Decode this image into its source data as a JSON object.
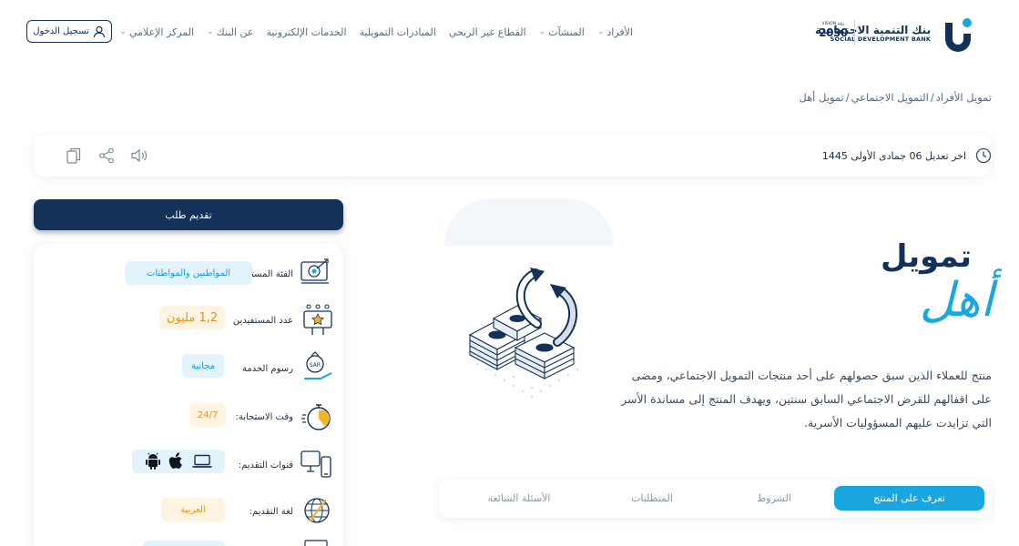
{
  "header": {
    "logo_ar": "بنك التنمية الاجتماعية",
    "logo_en": "SOCIAL DEVELOPMENT BANK",
    "vision_small": "رؤية VISION",
    "vision_big": "2030",
    "nav": [
      {
        "label": "الأفراد",
        "has_dropdown": true
      },
      {
        "label": "المنشآت",
        "has_dropdown": true
      },
      {
        "label": "القطاع غير الربحي",
        "has_dropdown": false
      },
      {
        "label": "المبادرات التمويلية",
        "has_dropdown": false
      },
      {
        "label": "الخدمات الإلكترونية",
        "has_dropdown": false
      },
      {
        "label": "عن البنك",
        "has_dropdown": true
      },
      {
        "label": "المركز الإعلامي",
        "has_dropdown": true
      }
    ],
    "login_label": "تسجيل الدخول"
  },
  "breadcrumb": [
    "تمويل الأفراد",
    "/",
    "التمويل الاجتماعي",
    "/",
    "تمويل أهل"
  ],
  "infobar": {
    "updated_label": "اخر تعديل 06 جمادى الأولى 1445"
  },
  "sidebar": {
    "apply_label": "تقديم طلب",
    "rows": [
      {
        "label": "الفئة المستهدفة",
        "value": "المواطنين والمواطنات"
      },
      {
        "label": "عدد المستفيدين",
        "value": "1,2 مليون"
      },
      {
        "label": "رسوم الخدمة",
        "value": "مجانية"
      },
      {
        "label": "وقت الاستجابة:",
        "value": "24/7"
      },
      {
        "label": "قنوات التقديم:",
        "value": ""
      },
      {
        "label": "لغة التقديم:",
        "value": "العربية"
      }
    ]
  },
  "main": {
    "title_line1": "تمويل",
    "title_line2": "أهل",
    "description": "منتج للعملاء الذين سبق حصولهم على أحد منتجات التمويل الاجتماعي، ومضى على اقفالهم للقرض الاجتماعي السابق سنتين، ويهدف المنتج إلى مساندة الأسر التي تزايدت عليهم المسؤوليات الأسرية.",
    "tabs": [
      "تعرف على المنتج",
      "الشروط",
      "المتطلبات",
      "الأسئلة الشائعة"
    ],
    "active_tab": 0
  },
  "colors": {
    "navy": "#14315a",
    "accent": "#1aa6df",
    "pill_blue_bg": "#e3f3fb",
    "pill_orange_bg": "#fff4e2",
    "pill_orange_text": "#e0961c"
  }
}
